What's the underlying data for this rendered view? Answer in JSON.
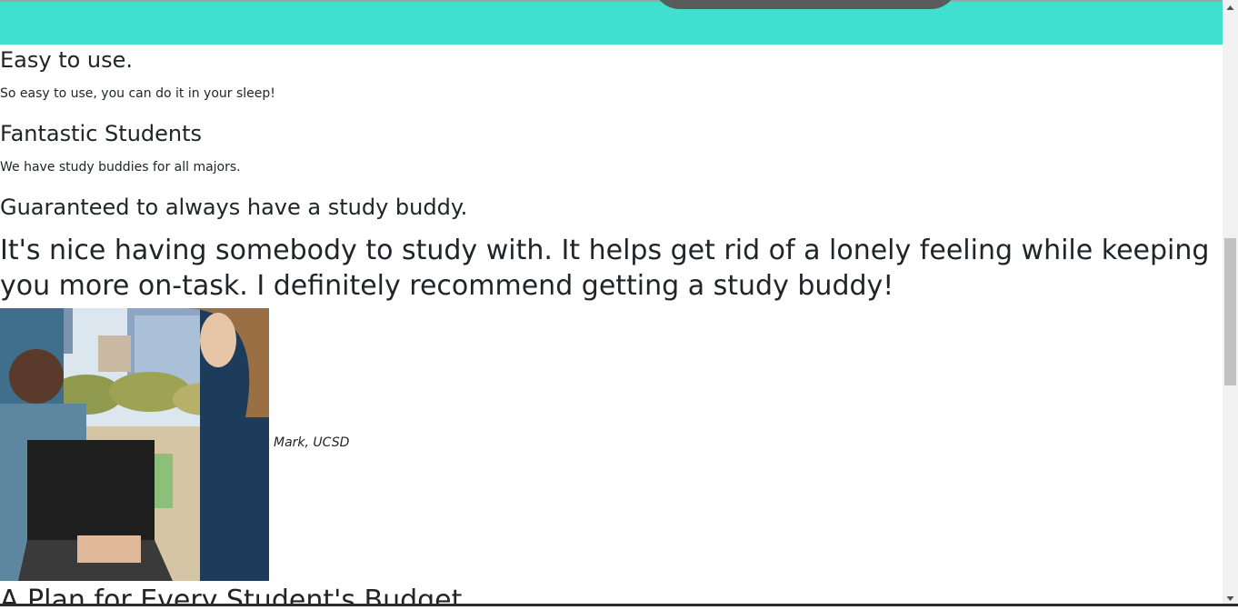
{
  "features": [
    {
      "heading": "Easy to use.",
      "text": "So easy to use, you can do it in your sleep!"
    },
    {
      "heading": "Fantastic Students",
      "text": "We have study buddies for all majors."
    },
    {
      "heading": "Guaranteed to always have a study buddy."
    }
  ],
  "testimonial": {
    "quote": "It's nice having somebody to study with. It helps get rid of a lonely feeling while keeping you more on-task. I definitely recommend getting a study buddy!",
    "caption": "Mark, UCSD"
  },
  "pricing": {
    "heading": "A Plan for Every Student's Budget"
  },
  "colors": {
    "banner": "#40e0d0",
    "text": "#212529"
  }
}
